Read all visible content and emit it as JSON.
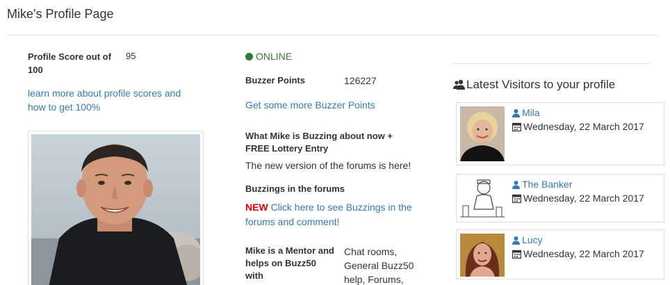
{
  "page": {
    "title": "Mike's Profile Page"
  },
  "profile": {
    "score_label": "Profile Score out of 100",
    "score_value": "95",
    "score_link": "learn more about profile scores and how to get 100%"
  },
  "status": {
    "online_text": "ONLINE",
    "online_color": "#3c763d"
  },
  "buzzer": {
    "label": "Buzzer Points",
    "value": "126227",
    "link": "Get some more Buzzer Points"
  },
  "buzzing": {
    "heading": "What Mike is Buzzing about now + FREE Lottery Entry",
    "text": "The new version of the forums is here!"
  },
  "forums": {
    "heading": "Buzzings in the forums",
    "new_badge": "NEW",
    "link": "Click here to see Buzzings in the forums and comment!"
  },
  "mentor": {
    "heading": "Mike is a Mentor and helps on Buzz50 with",
    "topics": "Chat rooms, General Buzz50 help, Forums,"
  },
  "visitors": {
    "title": "Latest Visitors to your profile",
    "title_icon": "users-icon",
    "items": [
      {
        "name": "Mila",
        "date": "Wednesday, 22 March 2017"
      },
      {
        "name": "The Banker",
        "date": "Wednesday, 22 March 2017"
      },
      {
        "name": "Lucy",
        "date": "Wednesday, 22 March 2017"
      }
    ]
  },
  "colors": {
    "link": "#337ab7",
    "text": "#333333",
    "new_badge": "#e40000"
  }
}
